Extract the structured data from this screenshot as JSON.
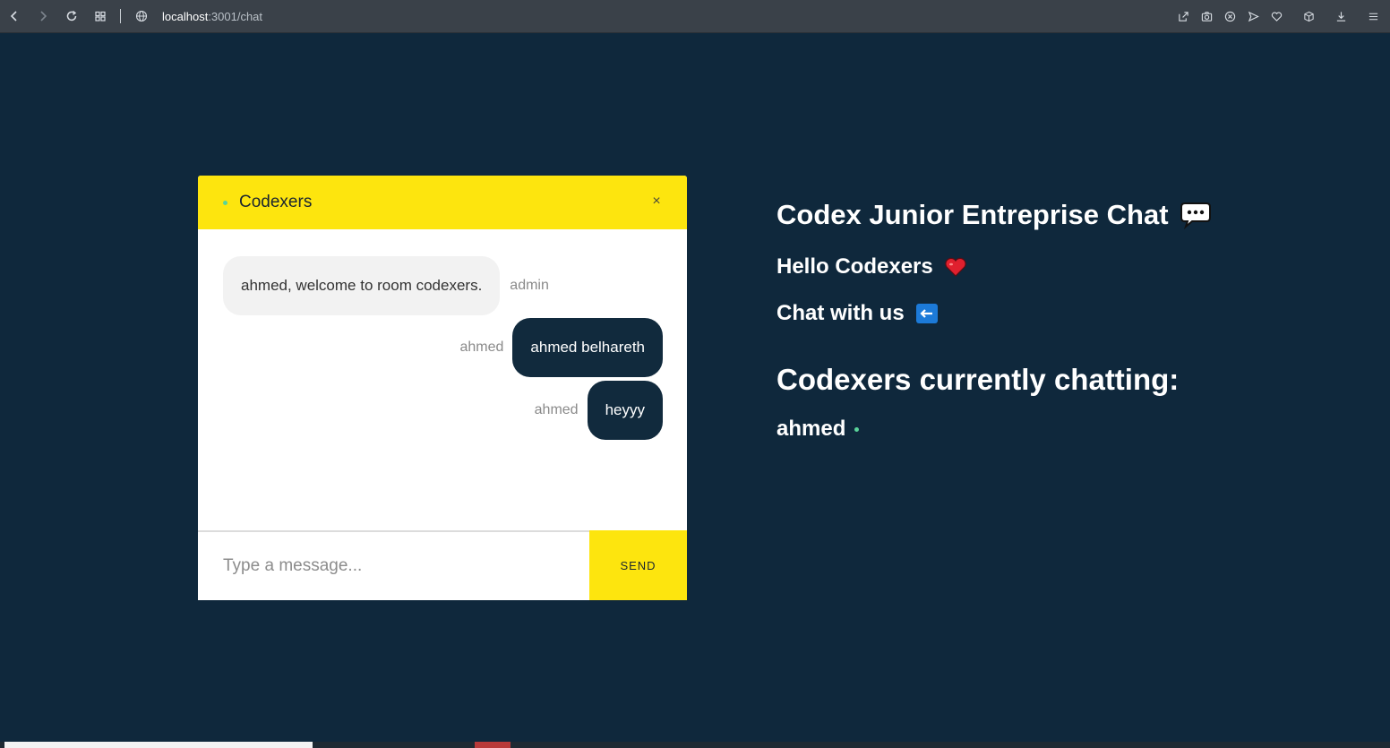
{
  "browser": {
    "url_host": "localhost",
    "url_path": ":3001/chat",
    "icons": [
      "back-icon",
      "forward-icon",
      "reload-icon",
      "tabs-grid-icon",
      "globe-icon",
      "share-icon",
      "camera-icon",
      "block-icon",
      "send-icon",
      "heart-icon",
      "cube-icon",
      "download-icon",
      "menu-icon"
    ]
  },
  "chat": {
    "room_name": "Codexers",
    "close_label": "×",
    "messages": [
      {
        "sender": "admin",
        "text": "ahmed, welcome to room codexers.",
        "own": false
      },
      {
        "sender": "ahmed",
        "text": "ahmed belhareth",
        "own": true
      },
      {
        "sender": "ahmed",
        "text": "heyyy",
        "own": true
      }
    ],
    "input_placeholder": "Type a message...",
    "send_label": "SEND"
  },
  "info": {
    "title": "Codex Junior Entreprise Chat",
    "hello": "Hello Codexers",
    "chat_with_us": "Chat with us",
    "currently_chatting": "Codexers currently chatting:",
    "users": [
      "ahmed"
    ]
  },
  "colors": {
    "background": "#0f283c",
    "accent_yellow": "#fde50e",
    "own_bubble": "#112a3d",
    "online": "#5ad49a"
  }
}
